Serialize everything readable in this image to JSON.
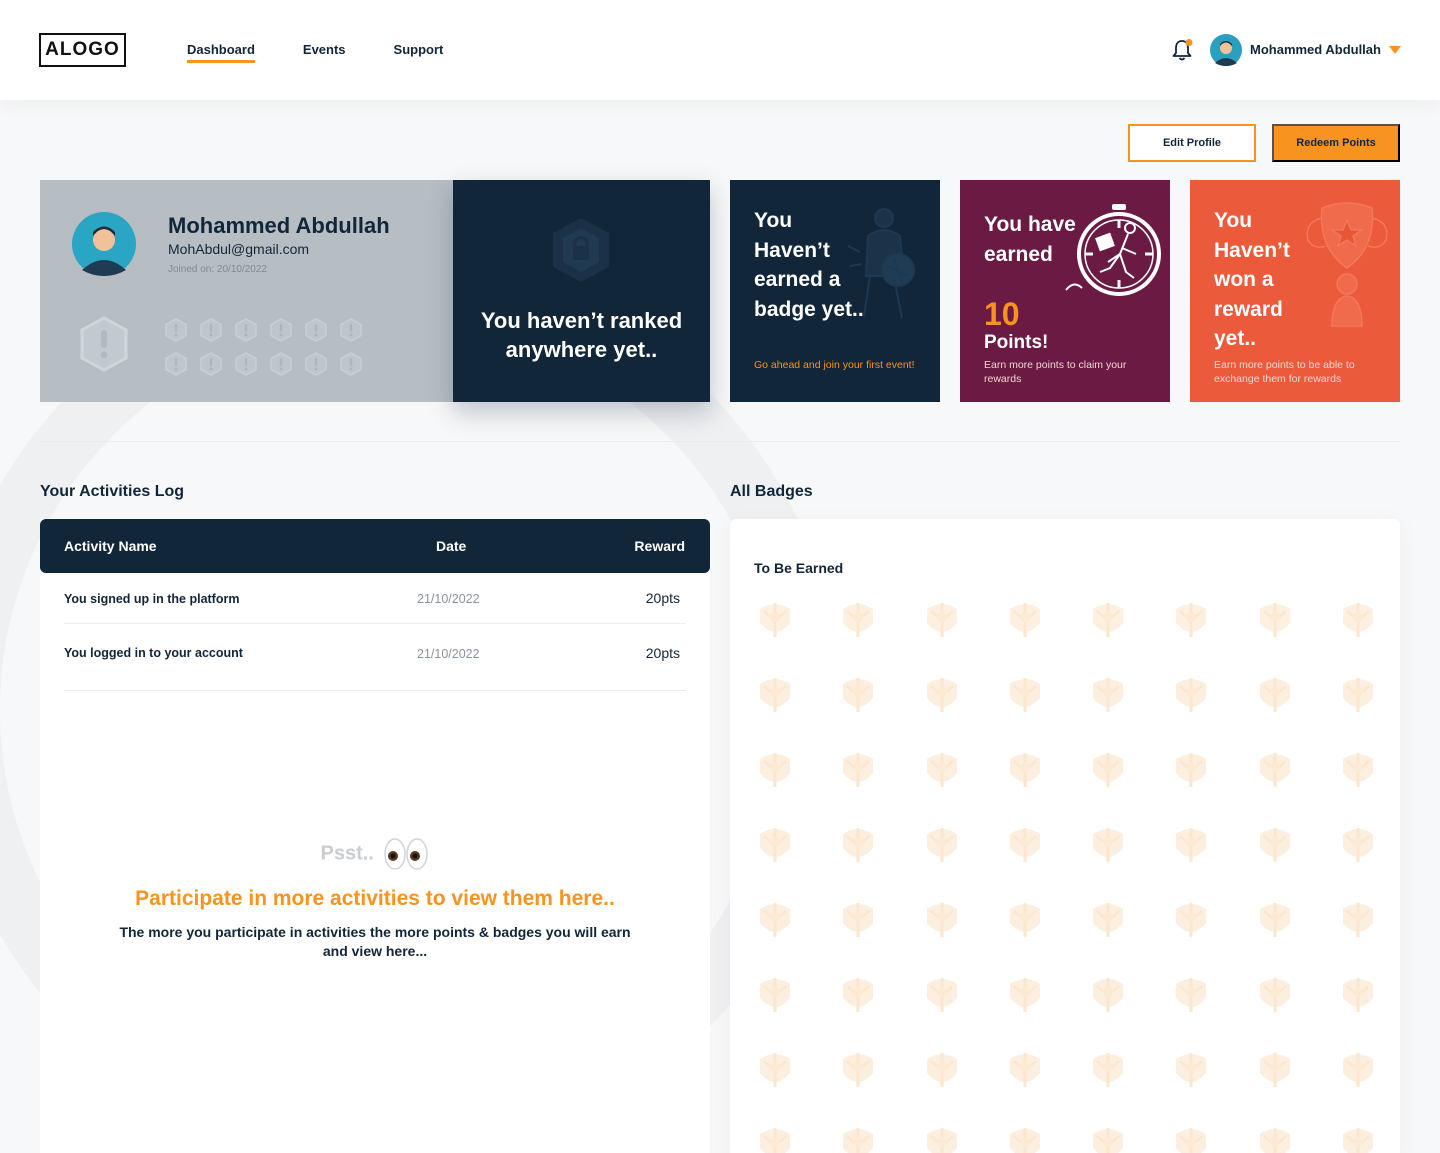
{
  "header": {
    "logo": "ALOGO",
    "nav": [
      "Dashboard",
      "Events",
      "Support"
    ],
    "active_nav": "Dashboard",
    "user_name": "Mohammed Abdullah"
  },
  "actions": {
    "edit_profile": "Edit Profile",
    "redeem_points": "Redeem Points"
  },
  "profile": {
    "name": "Mohammed Abdullah",
    "email": "MohAbdul@gmail.com",
    "joined": "Joined on: 20/10/2022"
  },
  "cards": {
    "rank": {
      "text": "You haven’t ranked anywhere yet.."
    },
    "badge": {
      "title": "You Haven’t earned a badge yet..",
      "subtitle": "Go ahead and join your first event!"
    },
    "points": {
      "title": "You have earned",
      "value": "10",
      "label": "Points!",
      "subtitle": "Earn more points to claim your rewards"
    },
    "reward": {
      "title": "You Haven’t won a reward yet..",
      "subtitle": "Earn more points to be able to exchange them for rewards"
    }
  },
  "activities": {
    "section_title": "Your Activities Log",
    "columns": [
      "Activity Name",
      "Date",
      "Reward"
    ],
    "rows": [
      {
        "name": "You signed up in the platform",
        "date": "21/10/2022",
        "reward": "20pts"
      },
      {
        "name": "You logged in to your account",
        "date": "21/10/2022",
        "reward": "20pts"
      }
    ],
    "psst": "Psst..",
    "promo": "Participate in more activities to view them here..",
    "promo_sub": "The more you participate in activities the more points & badges you will earn and view here..."
  },
  "badges": {
    "section_title": "All Badges",
    "subtitle": "To Be Earned"
  },
  "colors": {
    "navy": "#12263a",
    "orange": "#f7931e",
    "plum": "#6a1a43",
    "coral": "#ec5a3c",
    "gray_card": "#b6bec4"
  },
  "icons": [
    "bell-icon",
    "avatar",
    "chevron-down-icon",
    "rank-shield-icon",
    "badge-placeholder-icon"
  ]
}
